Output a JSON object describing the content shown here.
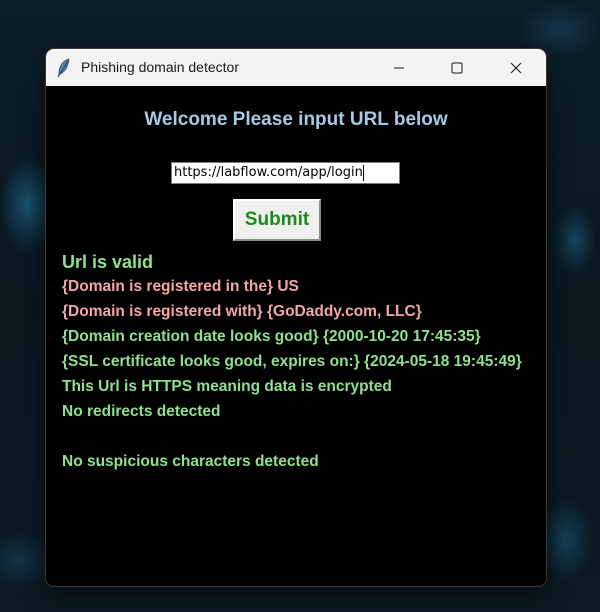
{
  "window": {
    "title": "Phishing domain detector",
    "icon": "feather-icon"
  },
  "form": {
    "welcome": "Welcome Please input URL below",
    "url_value": "https://labflow.com/app/login",
    "submit_label": "Submit"
  },
  "results": {
    "valid": "Url is valid",
    "country": "{Domain is registered in the} US",
    "registrar": "{Domain is registered with} {GoDaddy.com, LLC}",
    "creation": "{Domain creation date looks good} {2000-10-20 17:45:35}",
    "ssl": "{SSL certificate looks good, expires on:} {2024-05-18 19:45:49}",
    "https": "This Url is HTTPS meaning data is encrypted",
    "redirects": "No redirects detected",
    "suspicious": "No suspicious characters detected"
  },
  "colors": {
    "welcome": "#a9c8e4",
    "submit_text": "#1a8a1a",
    "valid_green": "#8fe08f",
    "warning_pink": "#f4a6a6",
    "background": "#000000"
  }
}
